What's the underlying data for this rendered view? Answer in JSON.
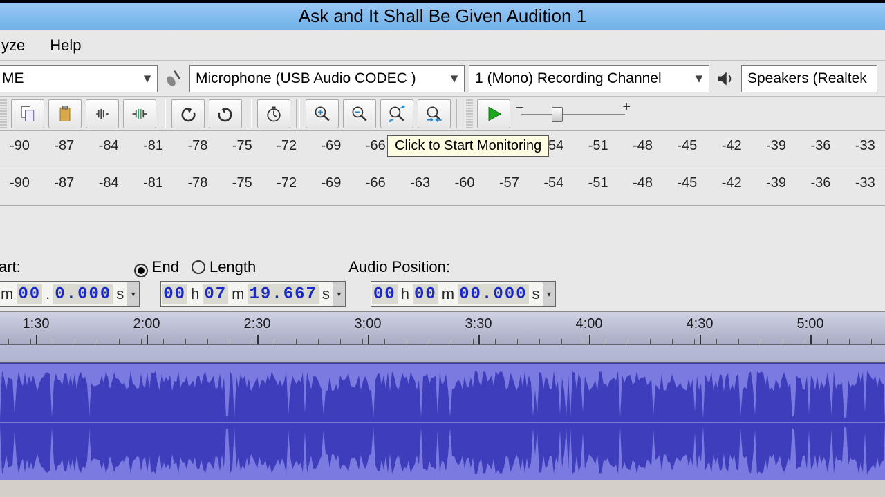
{
  "title": "Ask and It Shall Be Given Audition 1",
  "menu": {
    "analyze_partial": "yze",
    "help": "Help"
  },
  "devices": {
    "host_partial": "ME",
    "input": "Microphone (USB Audio CODEC )",
    "channels": "1 (Mono) Recording Channel",
    "output_partial": "Speakers (Realtek"
  },
  "meter": {
    "ticks": [
      "-90",
      "-87",
      "-84",
      "-81",
      "-78",
      "-75",
      "-72",
      "-69",
      "-66",
      "-63",
      "-60",
      "-57",
      "-54",
      "-51",
      "-48",
      "-45",
      "-42",
      "-39",
      "-36",
      "-33"
    ],
    "tooltip_text": "Click to Start Monitoring"
  },
  "selection": {
    "start_label_partial": "art:",
    "end_label": "End",
    "length_label": "Length",
    "audio_position_label": "Audio Position:",
    "selected_radio": "end",
    "start_time_partial": {
      "m": "00",
      "s": "0.000"
    },
    "end_time": {
      "h": "00",
      "m": "07",
      "s": "19.667"
    },
    "audio_position": {
      "h": "00",
      "m": "00",
      "s": "00.000"
    }
  },
  "timeline": {
    "labels": [
      "1:30",
      "2:00",
      "2:30",
      "3:00",
      "3:30",
      "4:00",
      "4:30",
      "5:00"
    ]
  }
}
